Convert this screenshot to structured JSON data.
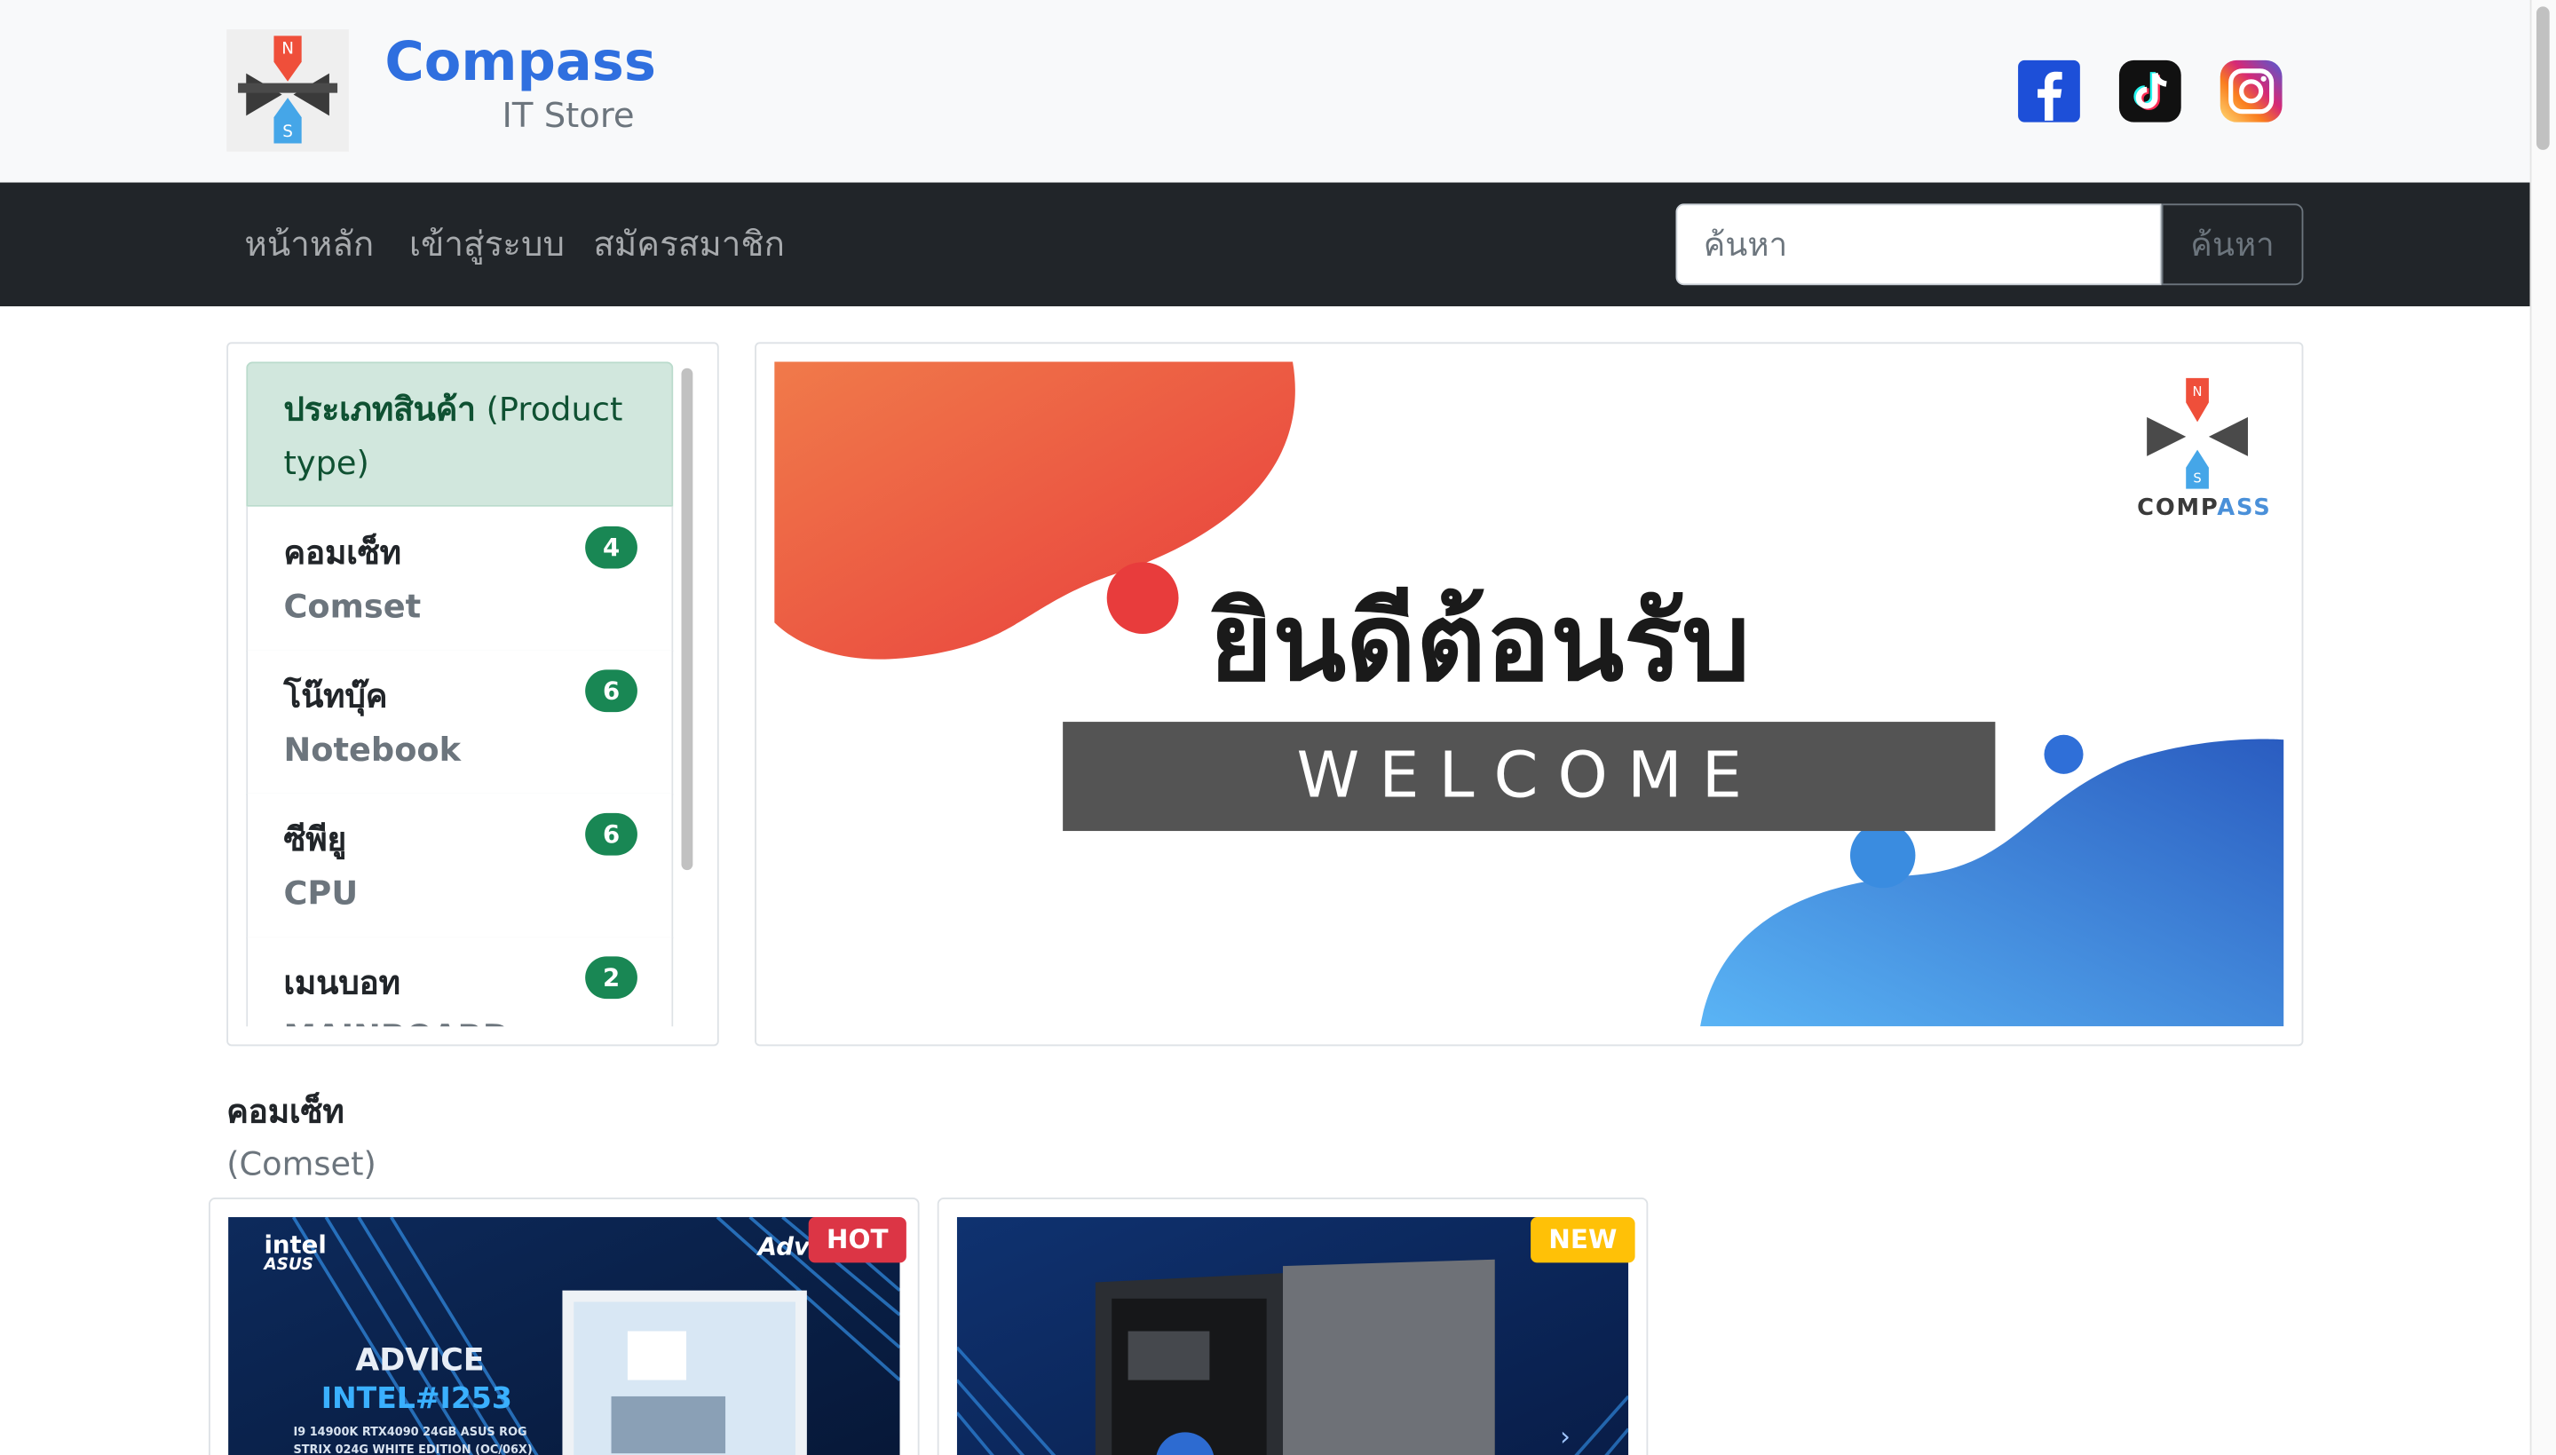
{
  "brand": {
    "name": "Compass",
    "subtitle": "IT Store"
  },
  "social": [
    "facebook-icon",
    "tiktok-icon",
    "instagram-icon"
  ],
  "nav": {
    "links": [
      "หน้าหลัก",
      "เข้าสู่ระบบ",
      "สมัครสมาชิก"
    ],
    "search": {
      "placeholder": "ค้นหา",
      "button_label": "ค้นหา"
    }
  },
  "sidebar": {
    "header_th": "ประเภทสินค้า",
    "header_en": "(Product type)",
    "items": [
      {
        "th": "คอมเซ็ท",
        "en": "Comset",
        "count": "4"
      },
      {
        "th": "โน๊ทบุ๊ค",
        "en": "Notebook",
        "count": "6"
      },
      {
        "th": "ซีพียู",
        "en": "CPU",
        "count": "6"
      },
      {
        "th": "เมนบอท",
        "en": "MAINBOARD",
        "count": "2"
      }
    ]
  },
  "banner": {
    "welcome_th": "ยินดีต้อนรับ",
    "welcome_en": "WELCOME",
    "logo_text_1": "COMP",
    "logo_text_2": "ASS",
    "logo_n": "N",
    "logo_s": "S"
  },
  "section": {
    "title_th": "คอมเซ็ท",
    "title_en": "(Comset)"
  },
  "products": [
    {
      "badge": "HOT",
      "image_text": {
        "brand_1": "intel",
        "brand_2": "ASUS",
        "corner": "Adv",
        "title_1": "ADVICE",
        "title_2": "INTEL#I253",
        "spec_1": "I9 14900K RTX4090 24GB ASUS ROG",
        "spec_2": "STRIX 024G WHITE EDITION (OC/06X)"
      }
    },
    {
      "badge": "NEW"
    }
  ],
  "colors": {
    "brand_blue": "#2f6fdf",
    "nav_bg": "#212529",
    "success_green": "#198754",
    "hot_red": "#dc3545",
    "new_yellow": "#ffc107"
  }
}
